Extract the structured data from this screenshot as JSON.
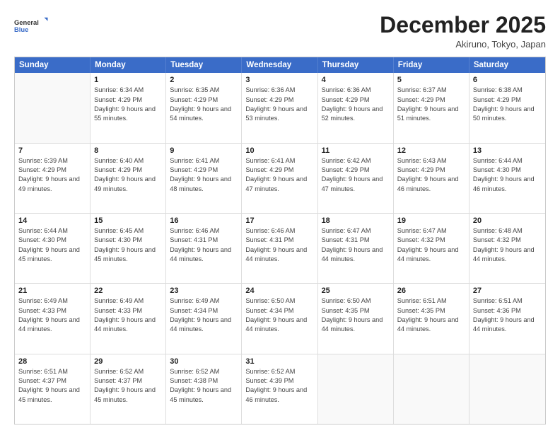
{
  "header": {
    "logo_general": "General",
    "logo_blue": "Blue",
    "month": "December 2025",
    "location": "Akiruno, Tokyo, Japan"
  },
  "weekdays": [
    "Sunday",
    "Monday",
    "Tuesday",
    "Wednesday",
    "Thursday",
    "Friday",
    "Saturday"
  ],
  "rows": [
    [
      {
        "day": "",
        "sunrise": "",
        "sunset": "",
        "daylight": ""
      },
      {
        "day": "1",
        "sunrise": "Sunrise: 6:34 AM",
        "sunset": "Sunset: 4:29 PM",
        "daylight": "Daylight: 9 hours and 55 minutes."
      },
      {
        "day": "2",
        "sunrise": "Sunrise: 6:35 AM",
        "sunset": "Sunset: 4:29 PM",
        "daylight": "Daylight: 9 hours and 54 minutes."
      },
      {
        "day": "3",
        "sunrise": "Sunrise: 6:36 AM",
        "sunset": "Sunset: 4:29 PM",
        "daylight": "Daylight: 9 hours and 53 minutes."
      },
      {
        "day": "4",
        "sunrise": "Sunrise: 6:36 AM",
        "sunset": "Sunset: 4:29 PM",
        "daylight": "Daylight: 9 hours and 52 minutes."
      },
      {
        "day": "5",
        "sunrise": "Sunrise: 6:37 AM",
        "sunset": "Sunset: 4:29 PM",
        "daylight": "Daylight: 9 hours and 51 minutes."
      },
      {
        "day": "6",
        "sunrise": "Sunrise: 6:38 AM",
        "sunset": "Sunset: 4:29 PM",
        "daylight": "Daylight: 9 hours and 50 minutes."
      }
    ],
    [
      {
        "day": "7",
        "sunrise": "Sunrise: 6:39 AM",
        "sunset": "Sunset: 4:29 PM",
        "daylight": "Daylight: 9 hours and 49 minutes."
      },
      {
        "day": "8",
        "sunrise": "Sunrise: 6:40 AM",
        "sunset": "Sunset: 4:29 PM",
        "daylight": "Daylight: 9 hours and 49 minutes."
      },
      {
        "day": "9",
        "sunrise": "Sunrise: 6:41 AM",
        "sunset": "Sunset: 4:29 PM",
        "daylight": "Daylight: 9 hours and 48 minutes."
      },
      {
        "day": "10",
        "sunrise": "Sunrise: 6:41 AM",
        "sunset": "Sunset: 4:29 PM",
        "daylight": "Daylight: 9 hours and 47 minutes."
      },
      {
        "day": "11",
        "sunrise": "Sunrise: 6:42 AM",
        "sunset": "Sunset: 4:29 PM",
        "daylight": "Daylight: 9 hours and 47 minutes."
      },
      {
        "day": "12",
        "sunrise": "Sunrise: 6:43 AM",
        "sunset": "Sunset: 4:29 PM",
        "daylight": "Daylight: 9 hours and 46 minutes."
      },
      {
        "day": "13",
        "sunrise": "Sunrise: 6:44 AM",
        "sunset": "Sunset: 4:30 PM",
        "daylight": "Daylight: 9 hours and 46 minutes."
      }
    ],
    [
      {
        "day": "14",
        "sunrise": "Sunrise: 6:44 AM",
        "sunset": "Sunset: 4:30 PM",
        "daylight": "Daylight: 9 hours and 45 minutes."
      },
      {
        "day": "15",
        "sunrise": "Sunrise: 6:45 AM",
        "sunset": "Sunset: 4:30 PM",
        "daylight": "Daylight: 9 hours and 45 minutes."
      },
      {
        "day": "16",
        "sunrise": "Sunrise: 6:46 AM",
        "sunset": "Sunset: 4:31 PM",
        "daylight": "Daylight: 9 hours and 44 minutes."
      },
      {
        "day": "17",
        "sunrise": "Sunrise: 6:46 AM",
        "sunset": "Sunset: 4:31 PM",
        "daylight": "Daylight: 9 hours and 44 minutes."
      },
      {
        "day": "18",
        "sunrise": "Sunrise: 6:47 AM",
        "sunset": "Sunset: 4:31 PM",
        "daylight": "Daylight: 9 hours and 44 minutes."
      },
      {
        "day": "19",
        "sunrise": "Sunrise: 6:47 AM",
        "sunset": "Sunset: 4:32 PM",
        "daylight": "Daylight: 9 hours and 44 minutes."
      },
      {
        "day": "20",
        "sunrise": "Sunrise: 6:48 AM",
        "sunset": "Sunset: 4:32 PM",
        "daylight": "Daylight: 9 hours and 44 minutes."
      }
    ],
    [
      {
        "day": "21",
        "sunrise": "Sunrise: 6:49 AM",
        "sunset": "Sunset: 4:33 PM",
        "daylight": "Daylight: 9 hours and 44 minutes."
      },
      {
        "day": "22",
        "sunrise": "Sunrise: 6:49 AM",
        "sunset": "Sunset: 4:33 PM",
        "daylight": "Daylight: 9 hours and 44 minutes."
      },
      {
        "day": "23",
        "sunrise": "Sunrise: 6:49 AM",
        "sunset": "Sunset: 4:34 PM",
        "daylight": "Daylight: 9 hours and 44 minutes."
      },
      {
        "day": "24",
        "sunrise": "Sunrise: 6:50 AM",
        "sunset": "Sunset: 4:34 PM",
        "daylight": "Daylight: 9 hours and 44 minutes."
      },
      {
        "day": "25",
        "sunrise": "Sunrise: 6:50 AM",
        "sunset": "Sunset: 4:35 PM",
        "daylight": "Daylight: 9 hours and 44 minutes."
      },
      {
        "day": "26",
        "sunrise": "Sunrise: 6:51 AM",
        "sunset": "Sunset: 4:35 PM",
        "daylight": "Daylight: 9 hours and 44 minutes."
      },
      {
        "day": "27",
        "sunrise": "Sunrise: 6:51 AM",
        "sunset": "Sunset: 4:36 PM",
        "daylight": "Daylight: 9 hours and 44 minutes."
      }
    ],
    [
      {
        "day": "28",
        "sunrise": "Sunrise: 6:51 AM",
        "sunset": "Sunset: 4:37 PM",
        "daylight": "Daylight: 9 hours and 45 minutes."
      },
      {
        "day": "29",
        "sunrise": "Sunrise: 6:52 AM",
        "sunset": "Sunset: 4:37 PM",
        "daylight": "Daylight: 9 hours and 45 minutes."
      },
      {
        "day": "30",
        "sunrise": "Sunrise: 6:52 AM",
        "sunset": "Sunset: 4:38 PM",
        "daylight": "Daylight: 9 hours and 45 minutes."
      },
      {
        "day": "31",
        "sunrise": "Sunrise: 6:52 AM",
        "sunset": "Sunset: 4:39 PM",
        "daylight": "Daylight: 9 hours and 46 minutes."
      },
      {
        "day": "",
        "sunrise": "",
        "sunset": "",
        "daylight": ""
      },
      {
        "day": "",
        "sunrise": "",
        "sunset": "",
        "daylight": ""
      },
      {
        "day": "",
        "sunrise": "",
        "sunset": "",
        "daylight": ""
      }
    ]
  ]
}
